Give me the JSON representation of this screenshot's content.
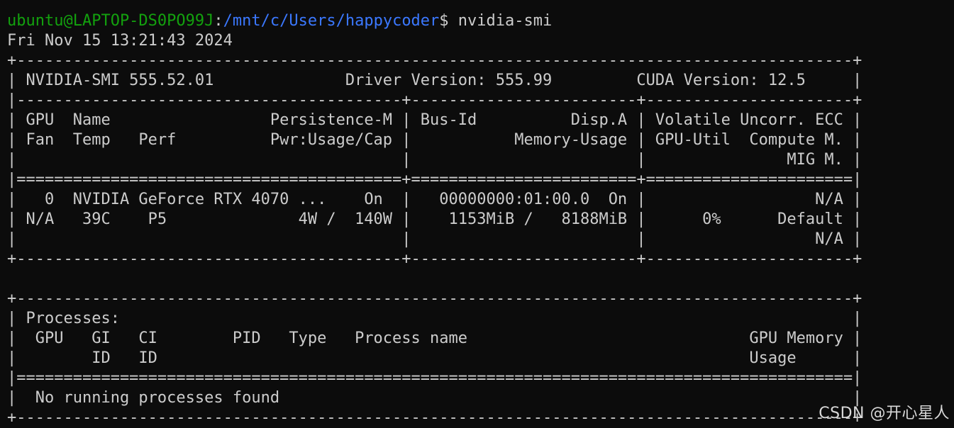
{
  "terminal": {
    "prompt": {
      "user_host": "ubuntu@LAPTOP-DS0PO99J",
      "separator": ":",
      "path": "/mnt/c/Users/happycoder",
      "symbol": "$",
      "command": " nvidia-smi"
    },
    "output_lines": [
      "Fri Nov 15 13:21:43 2024",
      "+-----------------------------------------------------------------------------------------+",
      "| NVIDIA-SMI 555.52.01              Driver Version: 555.99         CUDA Version: 12.5     |",
      "|-----------------------------------------+------------------------+----------------------+",
      "| GPU  Name                 Persistence-M | Bus-Id          Disp.A | Volatile Uncorr. ECC |",
      "| Fan  Temp   Perf          Pwr:Usage/Cap |           Memory-Usage | GPU-Util  Compute M. |",
      "|                                         |                        |               MIG M. |",
      "|=========================================+========================+======================|",
      "|   0  NVIDIA GeForce RTX 4070 ...    On  |   00000000:01:00.0  On |                  N/A |",
      "| N/A   39C    P5              4W /  140W |    1153MiB /   8188MiB |      0%      Default |",
      "|                                         |                        |                  N/A |",
      "+-----------------------------------------+------------------------+----------------------+",
      "",
      "+-----------------------------------------------------------------------------------------+",
      "| Processes:                                                                              |",
      "|  GPU   GI   CI        PID   Type   Process name                              GPU Memory |",
      "|        ID   ID                                                               Usage      |",
      "|=========================================================================================|",
      "|  No running processes found                                                             |",
      "+-----------------------------------------------------------------------------------------+"
    ]
  },
  "watermark": "CSDN @开心星人",
  "colors": {
    "background": "#0c0c0c",
    "text": "#cccccc",
    "prompt_user": "#13a10e",
    "prompt_path": "#3b78ff"
  }
}
